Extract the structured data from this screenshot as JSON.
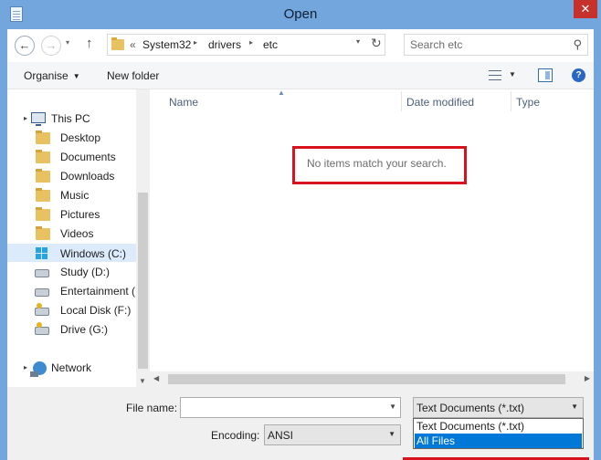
{
  "window": {
    "title": "Open",
    "close_glyph": "✕"
  },
  "nav": {
    "back": "←",
    "forward": "→",
    "up": "↑",
    "recent": "▾",
    "refresh": "↻",
    "dropdown": "▾"
  },
  "breadcrumb": {
    "more": "«",
    "items": [
      "System32",
      "drivers",
      "etc"
    ],
    "separator": "▸"
  },
  "search": {
    "placeholder": "Search etc",
    "icon": "⚲"
  },
  "toolbar": {
    "organise": "Organise",
    "organise_caret": "▼",
    "new_folder": "New folder",
    "view_caret": "▼",
    "help": "?"
  },
  "sidebar": {
    "this_pc": "This PC",
    "items": [
      "Desktop",
      "Documents",
      "Downloads",
      "Music",
      "Pictures",
      "Videos",
      "Windows (C:)",
      "Study (D:)",
      "Entertainment (E",
      "Local Disk (F:)",
      "Drive (G:)"
    ],
    "network": "Network",
    "expander": "▸",
    "scroll_down": "▼"
  },
  "file_list": {
    "columns": [
      "Name",
      "Date modified",
      "Type"
    ],
    "sort_glyph": "▲",
    "empty_message": "No items match your search.",
    "scroll_left": "◀",
    "scroll_right": "▶"
  },
  "footer": {
    "file_name_label": "File name:",
    "file_name_value": "",
    "file_type_selected": "Text Documents (*.txt)",
    "encoding_label": "Encoding:",
    "encoding_value": "ANSI",
    "dropdown_glyph": "▼",
    "file_type_options": [
      "Text Documents (*.txt)",
      "All Files"
    ],
    "highlighted_option": "All Files"
  },
  "colors": {
    "titlebar": "#72a6dd",
    "close": "#c7312b",
    "highlight_box": "#d9131d",
    "selection": "#0078d7",
    "nav_selected": "#dcebfc"
  }
}
